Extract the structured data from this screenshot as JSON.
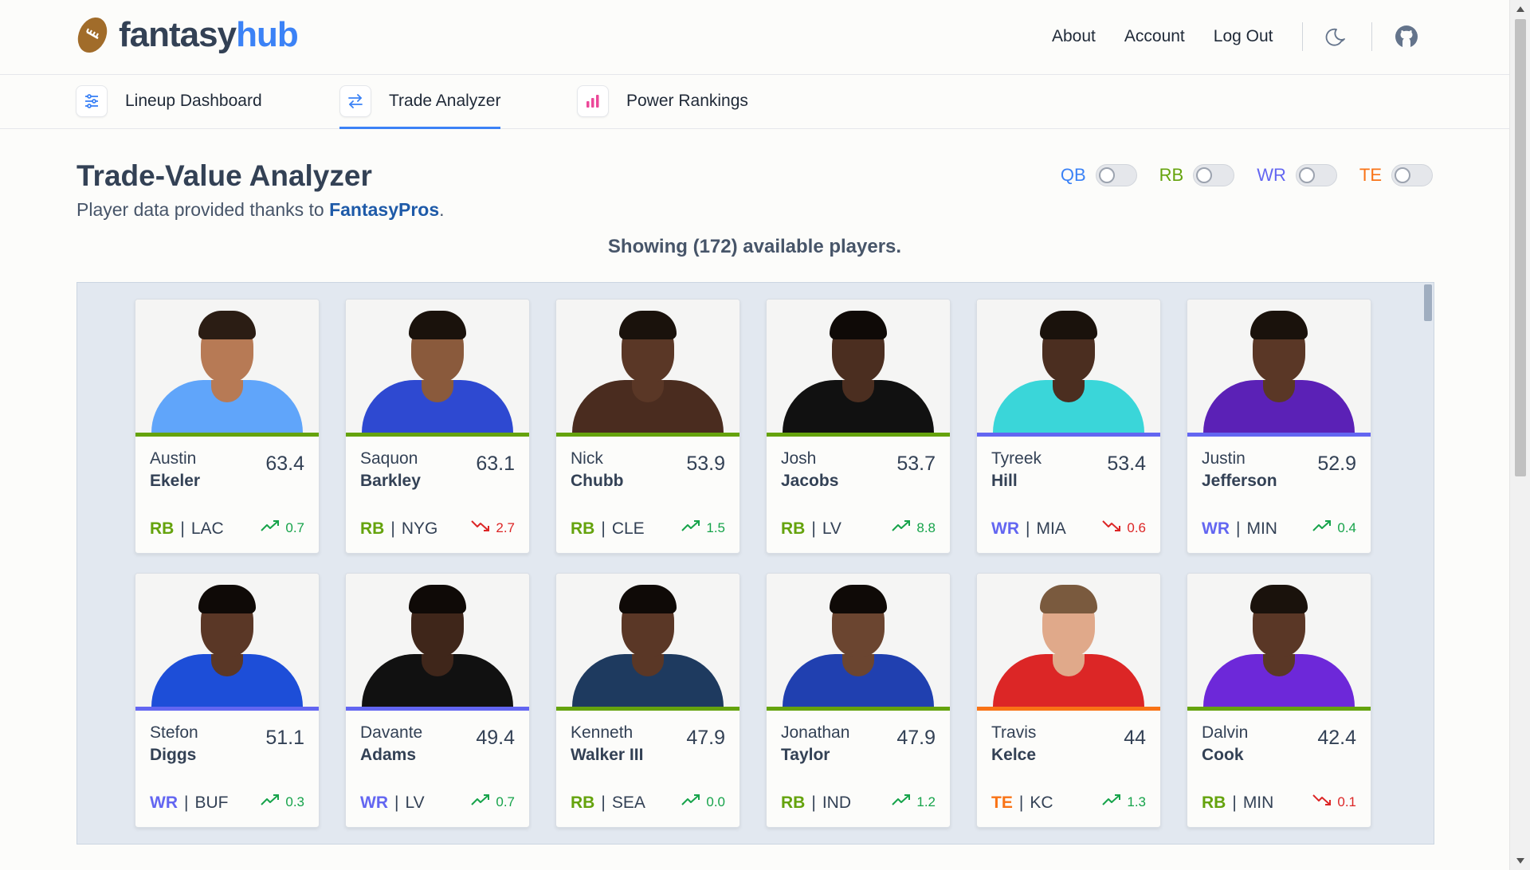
{
  "brand": {
    "name_part1": "fantasy",
    "name_part2": "hub"
  },
  "nav": {
    "about": "About",
    "account": "Account",
    "logout": "Log Out"
  },
  "tabs": [
    {
      "label": "Lineup Dashboard",
      "icon": "sliders-icon"
    },
    {
      "label": "Trade Analyzer",
      "icon": "swap-arrows-icon",
      "active": true
    },
    {
      "label": "Power Rankings",
      "icon": "bar-chart-icon"
    }
  ],
  "main": {
    "title": "Trade-Value Analyzer",
    "subtitle_prefix": "Player data provided thanks to ",
    "subtitle_link": "FantasyPros",
    "subtitle_suffix": ".",
    "showing": "Showing (172) available players."
  },
  "filters": [
    {
      "label": "QB",
      "color": "#3b82f6",
      "on": false
    },
    {
      "label": "RB",
      "color": "#65a30d",
      "on": false
    },
    {
      "label": "WR",
      "color": "#6366f1",
      "on": false
    },
    {
      "label": "TE",
      "color": "#f97316",
      "on": false
    }
  ],
  "colors": {
    "RB": "#65a30d",
    "WR": "#6366f1",
    "TE": "#f97316",
    "up": "#16a34a",
    "down": "#dc2626"
  },
  "players": [
    {
      "first": "Austin",
      "last": "Ekeler",
      "score": "63.4",
      "pos": "RB",
      "team": "LAC",
      "trend": "up",
      "delta": "0.7",
      "jersey": "#60a5fa",
      "skin": "#b77a55",
      "hair": "#2b1d14"
    },
    {
      "first": "Saquon",
      "last": "Barkley",
      "score": "63.1",
      "pos": "RB",
      "team": "NYG",
      "trend": "down",
      "delta": "2.7",
      "jersey": "#2e49d1",
      "skin": "#8a5a3c",
      "hair": "#1a120c"
    },
    {
      "first": "Nick",
      "last": "Chubb",
      "score": "53.9",
      "pos": "RB",
      "team": "CLE",
      "trend": "up",
      "delta": "1.5",
      "jersey": "#4a2c1f",
      "skin": "#5a3726",
      "hair": "#1a120c"
    },
    {
      "first": "Josh",
      "last": "Jacobs",
      "score": "53.7",
      "pos": "RB",
      "team": "LV",
      "trend": "up",
      "delta": "8.8",
      "jersey": "#111111",
      "skin": "#4b2e20",
      "hair": "#0f0a07"
    },
    {
      "first": "Tyreek",
      "last": "Hill",
      "score": "53.4",
      "pos": "WR",
      "team": "MIA",
      "trend": "down",
      "delta": "0.6",
      "jersey": "#3ad6d9",
      "skin": "#4b2e20",
      "hair": "#1a120c"
    },
    {
      "first": "Justin",
      "last": "Jefferson",
      "score": "52.9",
      "pos": "WR",
      "team": "MIN",
      "trend": "up",
      "delta": "0.4",
      "jersey": "#5b21b6",
      "skin": "#5a3726",
      "hair": "#1a120c"
    },
    {
      "first": "Stefon",
      "last": "Diggs",
      "score": "51.1",
      "pos": "WR",
      "team": "BUF",
      "trend": "up",
      "delta": "0.3",
      "jersey": "#1d4ed8",
      "skin": "#5a3726",
      "hair": "#0f0a07"
    },
    {
      "first": "Davante",
      "last": "Adams",
      "score": "49.4",
      "pos": "WR",
      "team": "LV",
      "trend": "up",
      "delta": "0.7",
      "jersey": "#111111",
      "skin": "#3f261a",
      "hair": "#0f0a07"
    },
    {
      "first": "Kenneth",
      "last": "Walker III",
      "score": "47.9",
      "pos": "RB",
      "team": "SEA",
      "trend": "up",
      "delta": "0.0",
      "jersey": "#1e3a5f",
      "skin": "#5a3726",
      "hair": "#0f0a07"
    },
    {
      "first": "Jonathan",
      "last": "Taylor",
      "score": "47.9",
      "pos": "RB",
      "team": "IND",
      "trend": "up",
      "delta": "1.2",
      "jersey": "#2040b0",
      "skin": "#6b4530",
      "hair": "#0f0a07"
    },
    {
      "first": "Travis",
      "last": "Kelce",
      "score": "44",
      "pos": "TE",
      "team": "KC",
      "trend": "up",
      "delta": "1.3",
      "jersey": "#dc2626",
      "skin": "#e0a98a",
      "hair": "#7a5a3e"
    },
    {
      "first": "Dalvin",
      "last": "Cook",
      "score": "42.4",
      "pos": "RB",
      "team": "MIN",
      "trend": "down",
      "delta": "0.1",
      "jersey": "#6d28d9",
      "skin": "#5a3726",
      "hair": "#1a120c"
    }
  ]
}
